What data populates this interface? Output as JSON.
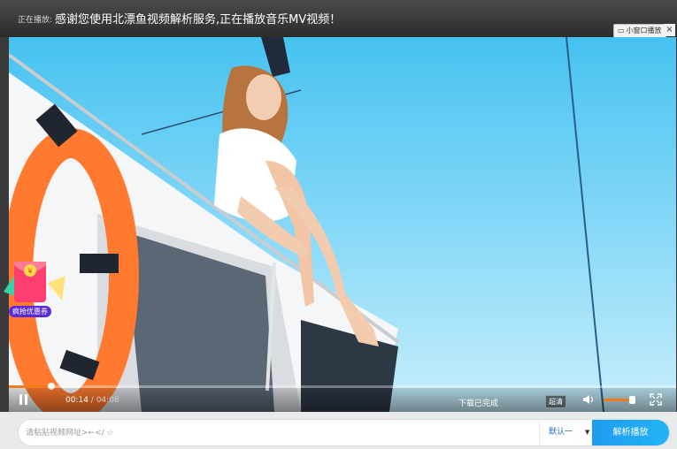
{
  "header": {
    "now_playing_label": "正在播放:",
    "title": "感谢您使用北漂鱼视频解析服务,正在播放音乐MV视频！",
    "mini_window_label": "小窗口播放",
    "close_symbol": "×"
  },
  "promo": {
    "coupon_label": "疯抢优惠券"
  },
  "player": {
    "current_time": "00:14",
    "separator": " / ",
    "duration": "04:08",
    "progress_fraction": 0.063,
    "load_status": "下载已完成",
    "quality": "超清",
    "volume_fraction": 0.9,
    "is_playing": true
  },
  "search": {
    "placeholder": "请粘贴视频网址>←</ ☆",
    "value": "",
    "source_selected": "默认一",
    "submit_label": "解析播放"
  },
  "colors": {
    "accent": "#f27a1a",
    "button": "#1f9bf0"
  }
}
